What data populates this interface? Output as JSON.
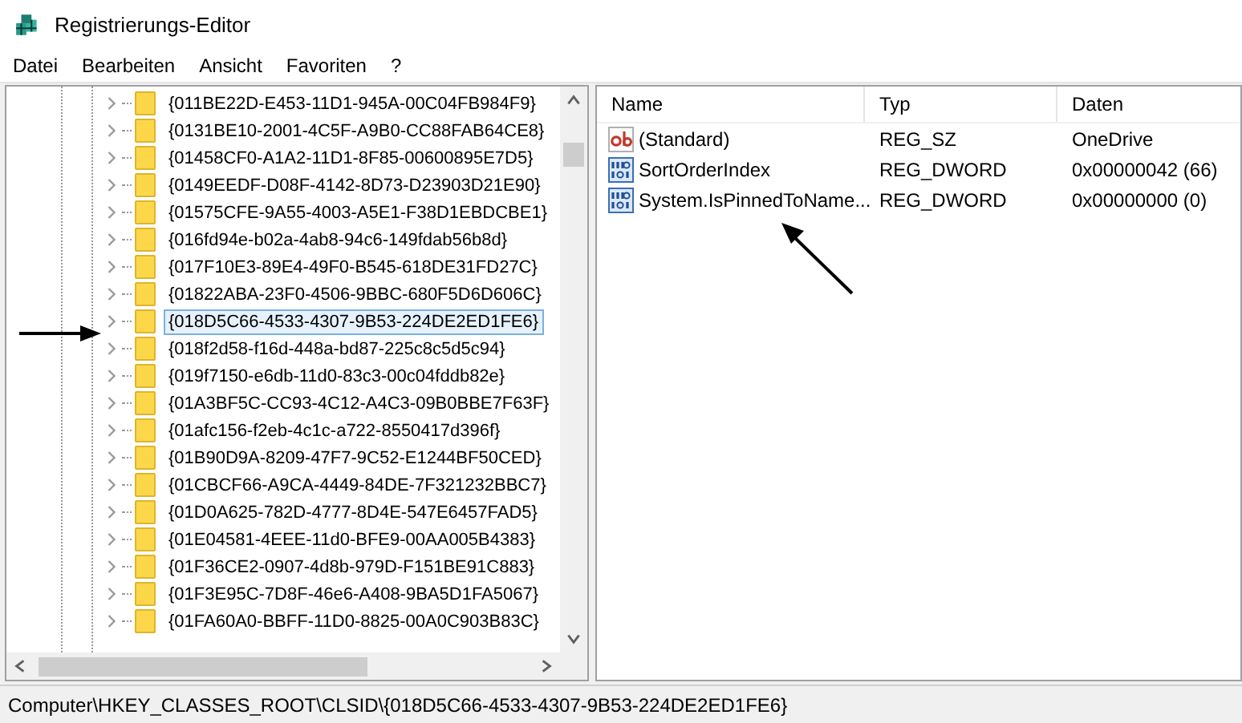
{
  "window": {
    "title": "Registrierungs-Editor"
  },
  "menu": [
    "Datei",
    "Bearbeiten",
    "Ansicht",
    "Favoriten",
    "?"
  ],
  "tree": {
    "items": [
      {
        "label": "{011BE22D-E453-11D1-945A-00C04FB984F9}",
        "selected": false
      },
      {
        "label": "{0131BE10-2001-4C5F-A9B0-CC88FAB64CE8}",
        "selected": false
      },
      {
        "label": "{01458CF0-A1A2-11D1-8F85-00600895E7D5}",
        "selected": false
      },
      {
        "label": "{0149EEDF-D08F-4142-8D73-D23903D21E90}",
        "selected": false
      },
      {
        "label": "{01575CFE-9A55-4003-A5E1-F38D1EBDCBE1}",
        "selected": false
      },
      {
        "label": "{016fd94e-b02a-4ab8-94c6-149fdab56b8d}",
        "selected": false
      },
      {
        "label": "{017F10E3-89E4-49F0-B545-618DE31FD27C}",
        "selected": false
      },
      {
        "label": "{01822ABA-23F0-4506-9BBC-680F5D6D606C}",
        "selected": false
      },
      {
        "label": "{018D5C66-4533-4307-9B53-224DE2ED1FE6}",
        "selected": true
      },
      {
        "label": "{018f2d58-f16d-448a-bd87-225c8c5d5c94}",
        "selected": false
      },
      {
        "label": "{019f7150-e6db-11d0-83c3-00c04fddb82e}",
        "selected": false
      },
      {
        "label": "{01A3BF5C-CC93-4C12-A4C3-09B0BBE7F63F}",
        "selected": false
      },
      {
        "label": "{01afc156-f2eb-4c1c-a722-8550417d396f}",
        "selected": false
      },
      {
        "label": "{01B90D9A-8209-47F7-9C52-E1244BF50CED}",
        "selected": false
      },
      {
        "label": "{01CBCF66-A9CA-4449-84DE-7F321232BBC7}",
        "selected": false
      },
      {
        "label": "{01D0A625-782D-4777-8D4E-547E6457FAD5}",
        "selected": false
      },
      {
        "label": "{01E04581-4EEE-11d0-BFE9-00AA005B4383}",
        "selected": false
      },
      {
        "label": "{01F36CE2-0907-4d8b-979D-F151BE91C883}",
        "selected": false
      },
      {
        "label": "{01F3E95C-7D8F-46e6-A408-9BA5D1FA5067}",
        "selected": false
      },
      {
        "label": "{01FA60A0-BBFF-11D0-8825-00A0C903B83C}",
        "selected": false
      }
    ]
  },
  "values": {
    "columns": [
      "Name",
      "Typ",
      "Daten"
    ],
    "rows": [
      {
        "kind": "string",
        "name": "(Standard)",
        "type": "REG_SZ",
        "data": "OneDrive"
      },
      {
        "kind": "dword",
        "name": "SortOrderIndex",
        "type": "REG_DWORD",
        "data": "0x00000042 (66)"
      },
      {
        "kind": "dword",
        "name": "System.IsPinnedToName...",
        "type": "REG_DWORD",
        "data": "0x00000000 (0)"
      }
    ]
  },
  "status_bar": "Computer\\HKEY_CLASSES_ROOT\\CLSID\\{018D5C66-4533-4307-9B53-224DE2ED1FE6}"
}
